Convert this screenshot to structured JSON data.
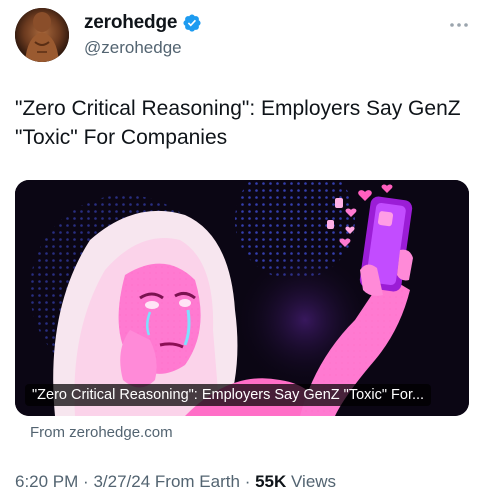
{
  "author": {
    "display_name": "zerohedge",
    "handle": "@zerohedge",
    "verified": true,
    "verified_color": "#1d9bf0"
  },
  "tweet": {
    "text": "\"Zero Critical Reasoning\": Employers Say GenZ \"Toxic\" For Companies"
  },
  "card": {
    "caption": "\"Zero Critical Reasoning\": Employers Say GenZ \"Toxic\" For...",
    "source": "From zerohedge.com"
  },
  "meta": {
    "time": "6:20 PM",
    "separator": "·",
    "date": "3/27/24",
    "location": "From Earth",
    "views_count": "55K",
    "views_label": "Views"
  },
  "icons": {
    "more": "more-horizontal-icon",
    "verified": "verified-badge-icon"
  }
}
